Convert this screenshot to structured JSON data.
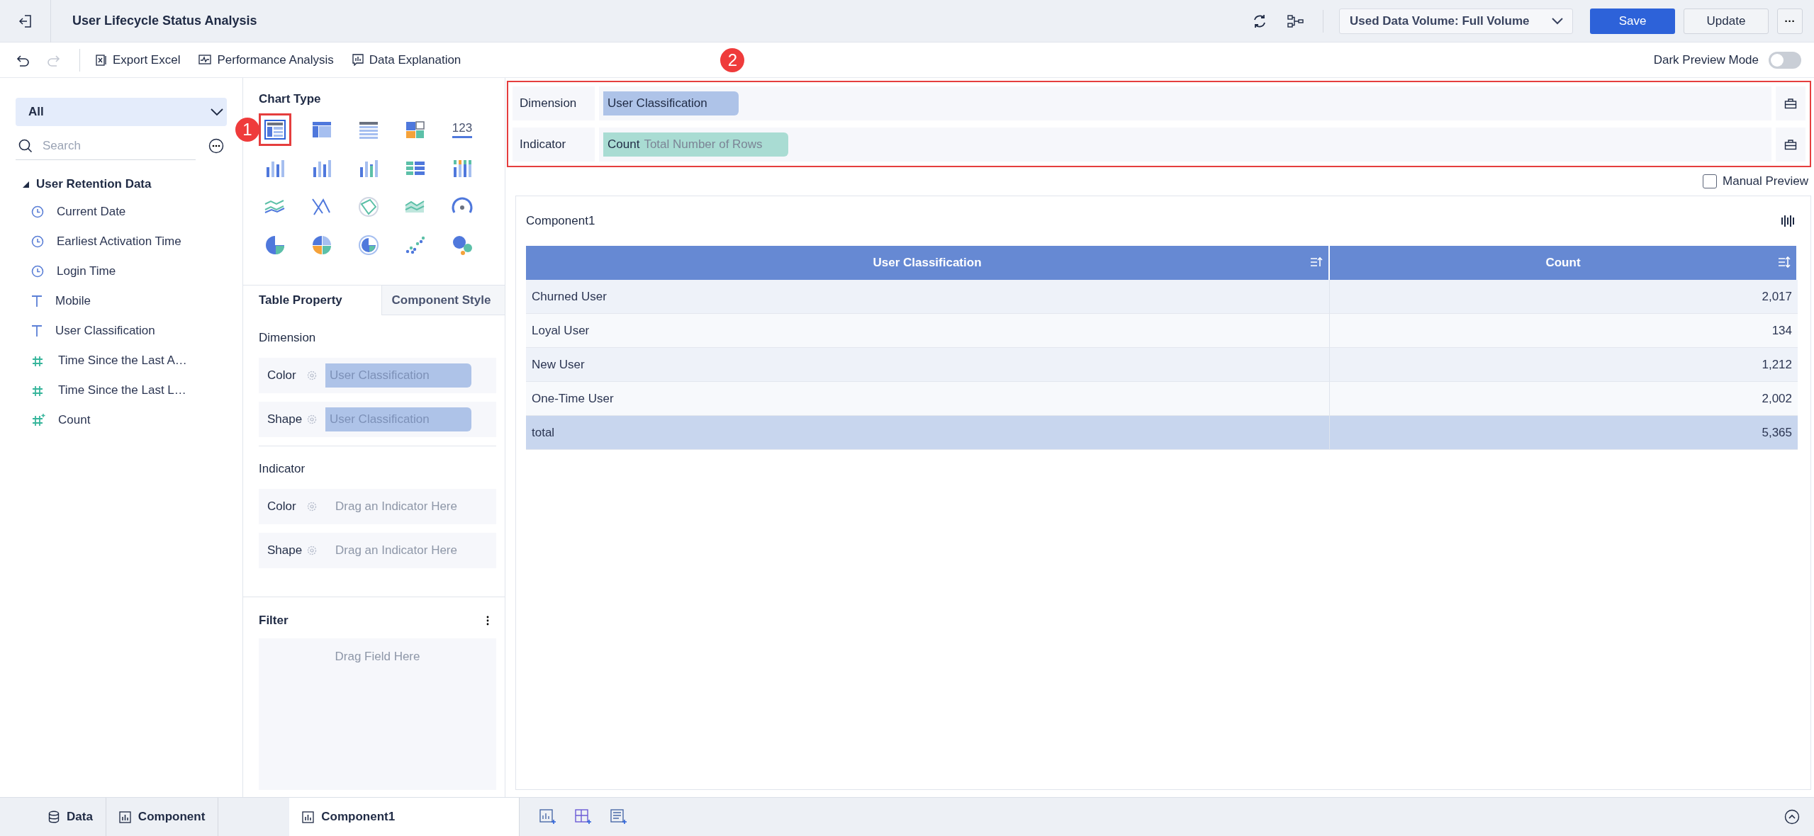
{
  "header": {
    "title": "User Lifecycle Status Analysis",
    "data_volume": "Used Data Volume: Full Volume",
    "save": "Save",
    "update": "Update",
    "more": "···"
  },
  "toolbar": {
    "items": [
      "Export Excel",
      "Performance Analysis",
      "Data Explanation"
    ],
    "dark_preview": {
      "label": "Dark Preview Mode",
      "on": false
    }
  },
  "annotations": [
    "1",
    "2"
  ],
  "field_panel": {
    "scope": "All",
    "search_placeholder": "Search",
    "tree": [
      {
        "label": "User Retention Data",
        "expanded": true,
        "children": [
          {
            "label": "Current Date",
            "kind": "date"
          },
          {
            "label": "Earliest Activation Time",
            "kind": "date"
          },
          {
            "label": "Login Time",
            "kind": "date"
          },
          {
            "label": "Mobile",
            "kind": "text"
          },
          {
            "label": "User Classification",
            "kind": "text"
          },
          {
            "label": "Time Since the Last A…",
            "kind": "number"
          },
          {
            "label": "Time Since the Last L…",
            "kind": "number"
          },
          {
            "label": "Count",
            "kind": "calculated"
          }
        ]
      }
    ]
  },
  "chart_panel": {
    "title": "Chart Type",
    "types": [
      {
        "selected": true
      },
      {
        "selected": false
      },
      {
        "selected": false
      },
      {
        "selected": false
      },
      {
        "selected": false
      },
      {
        "selected": false
      },
      {
        "selected": false
      },
      {
        "selected": false
      },
      {
        "selected": false
      },
      {
        "selected": false
      },
      {
        "selected": false
      },
      {
        "selected": false
      },
      {
        "selected": false
      },
      {
        "selected": false
      },
      {
        "selected": false
      },
      {
        "selected": false
      },
      {
        "selected": false
      },
      {
        "selected": false
      },
      {
        "selected": false
      },
      {
        "selected": false
      }
    ],
    "number_icon_text": "123",
    "tabs": [
      {
        "label": "Table Property",
        "selected": true
      },
      {
        "label": "Component Style",
        "selected": false
      }
    ],
    "sections": [
      {
        "title": "Dimension",
        "rows": [
          {
            "label": "Color",
            "value": "User Classification"
          },
          {
            "label": "Shape",
            "value": "User Classification"
          }
        ]
      },
      {
        "title": "Indicator",
        "rows": [
          {
            "label": "Color",
            "placeholder": "Drag an Indicator Here"
          },
          {
            "label": "Shape",
            "placeholder": "Drag an Indicator Here"
          }
        ]
      }
    ],
    "filter": {
      "title": "Filter",
      "placeholder": "Drag Field Here"
    }
  },
  "config": {
    "dimension": {
      "label": "Dimension",
      "fields": [
        {
          "name": "User Classification"
        }
      ]
    },
    "indicator": {
      "label": "Indicator",
      "fields": [
        {
          "name": "Count",
          "note": "Total Number of Rows"
        }
      ]
    }
  },
  "manual_preview": {
    "label": "Manual Preview",
    "checked": false
  },
  "component": {
    "title": "Component1",
    "table": {
      "columns": [
        "User Classification",
        "Count"
      ],
      "rows": [
        [
          "Churned User",
          "2,017"
        ],
        [
          "Loyal User",
          "134"
        ],
        [
          "New User",
          "1,212"
        ],
        [
          "One-Time User",
          "2,002"
        ]
      ],
      "total": [
        "total",
        "5,365"
      ]
    }
  },
  "bottom_bar": {
    "tabs": [
      {
        "label": "Data",
        "kind": "data",
        "selected": false
      },
      {
        "label": "Component",
        "kind": "component",
        "selected": false
      },
      {
        "label": "Component1",
        "kind": "component",
        "selected": true
      }
    ]
  }
}
